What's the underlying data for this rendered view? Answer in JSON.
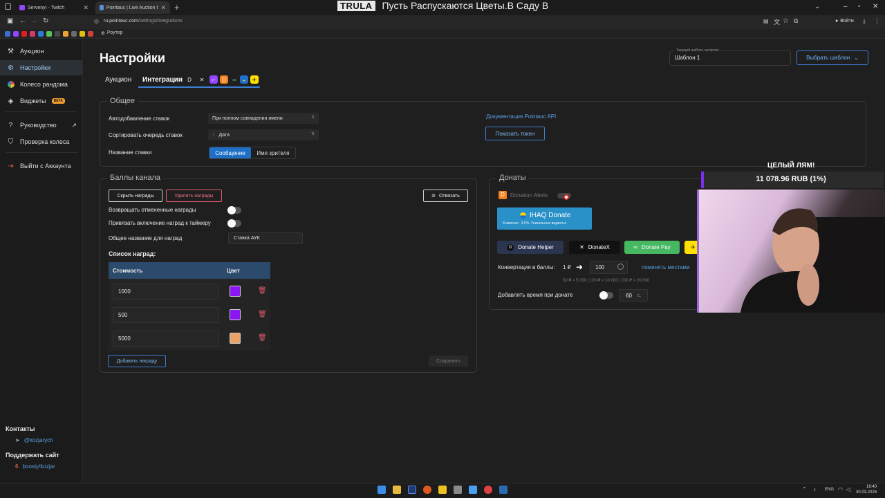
{
  "browser": {
    "tabs": [
      {
        "label": "Servenyi - Twitch",
        "color": "#9146ff"
      },
      {
        "label": "Pointauc | Live Auction for Stre…",
        "color": "#5c8dd6"
      }
    ],
    "url_domain": "ru.pointauc.com",
    "url_path": "/settings/integrations",
    "bookmark_label": "Роутер",
    "login_label": "Войти",
    "now_playing_brand": "TRULA",
    "now_playing_title": "Пусть Распускаются Цветы.В Саду В"
  },
  "sidebar": {
    "items": [
      {
        "label": "Аукцион",
        "icon": "gavel-icon"
      },
      {
        "label": "Настройки",
        "icon": "gear-icon"
      },
      {
        "label": "Колесо рандома",
        "icon": "wheel-icon"
      },
      {
        "label": "Виджеты",
        "icon": "layers-icon",
        "badge": "BETA"
      },
      {
        "label": "Руководство",
        "icon": "help-icon"
      },
      {
        "label": "Проверка колеса",
        "icon": "shield-icon"
      },
      {
        "label": "Выйти с Аккаунта",
        "icon": "logout-icon"
      }
    ],
    "contacts_title": "Контакты",
    "contact_link": "@kozjarych",
    "support_title": "Поддержать сайт",
    "support_link": "boosty/kozjar"
  },
  "page": {
    "title": "Настройки",
    "tabs": [
      "Аукцион",
      "Интеграции"
    ],
    "template_label": "Текущий шаблон настроек",
    "template_value": "Шаблон 1",
    "template_button": "Выбрать шаблон"
  },
  "general": {
    "title": "Общее",
    "auto_add_label": "Автодобавление ставок",
    "auto_add_value": "При полном совпадении имени",
    "sort_label": "Сортировать очередь ставок",
    "sort_value": "Дата",
    "bid_name_label": "Название ставки",
    "bid_name_options": [
      "Сообщение",
      "Имя зрителя"
    ],
    "api_doc_link": "Документация Pointauc API",
    "show_token_button": "Показать токен"
  },
  "points": {
    "title": "Баллы канала",
    "hide_button": "Скрыть награды",
    "delete_button": "Удалить награды",
    "unlink_button": "Отвязать",
    "return_label": "Возвращать отмененные награды",
    "timer_label": "Привязать включение наград к таймеру",
    "common_name_label": "Общее название для наград",
    "common_name_value": "Ставка АУК",
    "list_title": "Список наград:",
    "col_cost": "Стоимость",
    "col_color": "Цвет",
    "rewards": [
      {
        "cost": "1000",
        "color": "#8a16f0"
      },
      {
        "cost": "500",
        "color": "#8a16f0"
      },
      {
        "cost": "5000",
        "color": "#e8a36a"
      }
    ],
    "add_button": "Добавить награду",
    "save_button": "Сохранить"
  },
  "donations": {
    "title": "Донаты",
    "alerts_label": "Donation Alerts",
    "ihaq_title": "IHAQ Donate",
    "ihaq_sub": "Комиссия - 3,5%. Уникальные виджеты!",
    "services": [
      "Donate Helper",
      "DonateX",
      "Donate Pay"
    ],
    "conversion_label": "Конвертация в баллы:",
    "conversion_from": "1 ₽",
    "conversion_to": "100",
    "swap_link": "поменять местами",
    "conversion_hint": "50 ₽ > 5 000 | 100 ₽ > 10 000 | 200 ₽ > 20 000",
    "add_time_label": "Добавлять время при донате",
    "add_time_value": "60",
    "add_time_unit": "с."
  },
  "overlay": {
    "goal_label": "ЦЕЛЫЙ ЛЯМ!",
    "goal_amount": "11 078.96 RUB (1%)"
  },
  "taskbar": {
    "lang": "ENG",
    "time": "16:40",
    "date": "30.03.2026"
  }
}
